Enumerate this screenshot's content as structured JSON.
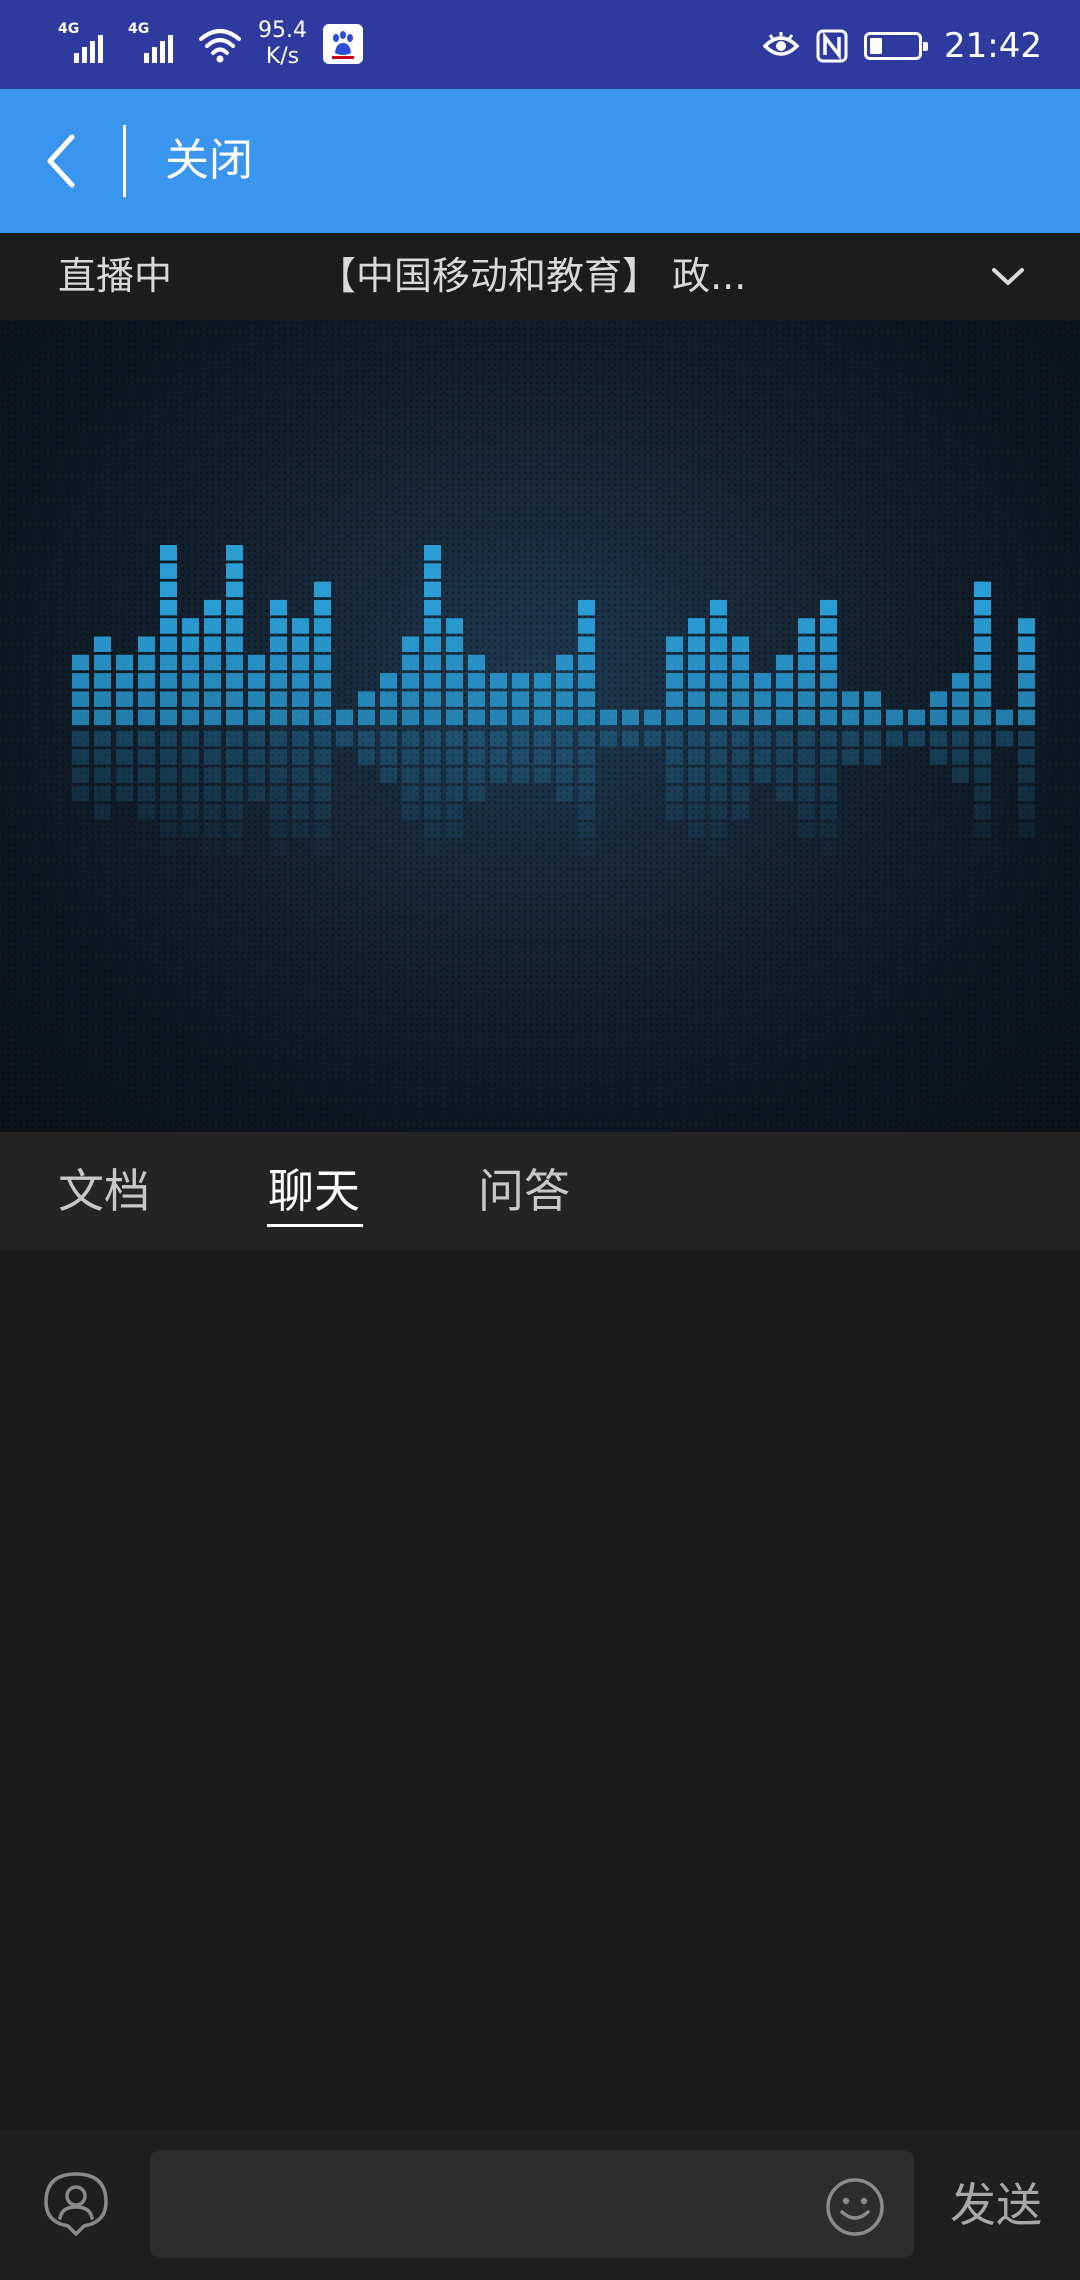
{
  "status_bar": {
    "signal_1_label": "4G",
    "signal_2_label": "4G",
    "net_speed_value": "95.4",
    "net_speed_unit": "K/s",
    "time": "21:42"
  },
  "header": {
    "close_label": "关闭"
  },
  "live": {
    "status": "直播中",
    "title": "【中国移动和教育】 政..."
  },
  "tabs": [
    {
      "label": "文档",
      "active": false
    },
    {
      "label": "聊天",
      "active": true
    },
    {
      "label": "问答",
      "active": false
    }
  ],
  "composer": {
    "input_value": "",
    "input_placeholder": "",
    "send_label": "发送"
  },
  "equalizer": {
    "levels": [
      4,
      5,
      4,
      5,
      10,
      6,
      7,
      10,
      4,
      7,
      6,
      8,
      1,
      2,
      3,
      5,
      10,
      6,
      4,
      3,
      3,
      3,
      4,
      7,
      1,
      1,
      1,
      5,
      6,
      7,
      5,
      3,
      4,
      6,
      7,
      2,
      2,
      1,
      1,
      2,
      3,
      8,
      1,
      6
    ],
    "color": "#2a9fd8"
  },
  "colors": {
    "status_bar": "#2e3a9e",
    "app_bar": "#3a95ef",
    "background": "#1b1b1b"
  }
}
